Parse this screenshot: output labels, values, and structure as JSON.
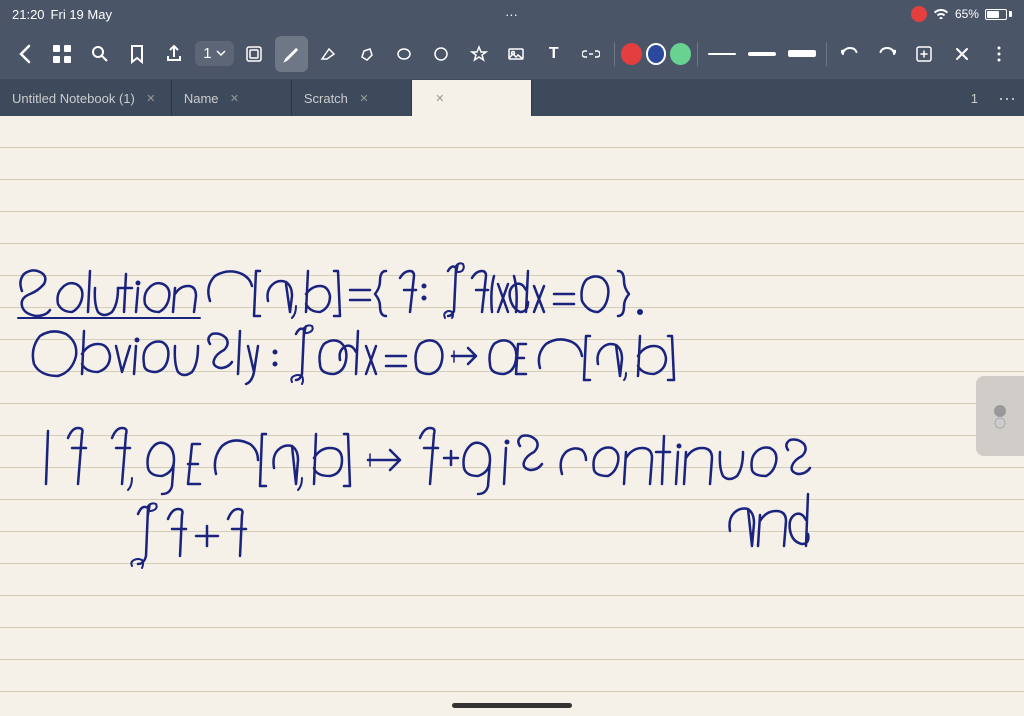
{
  "statusBar": {
    "time": "21:20",
    "day": "Fri 19 May",
    "dots": "···",
    "wifi": "65%"
  },
  "toolbar": {
    "pageIndicator": "1",
    "tools": [
      {
        "name": "back",
        "icon": "‹",
        "label": "back-button"
      },
      {
        "name": "grid",
        "icon": "⊞",
        "label": "grid-button"
      },
      {
        "name": "search",
        "icon": "🔍",
        "label": "search-button"
      },
      {
        "name": "bookmark",
        "icon": "🔖",
        "label": "bookmark-button"
      },
      {
        "name": "share",
        "icon": "⬆",
        "label": "share-button"
      }
    ],
    "drawTools": [
      {
        "name": "layers",
        "icon": "▣",
        "label": "layers-button"
      },
      {
        "name": "pen",
        "icon": "✏",
        "label": "pen-button",
        "active": true
      },
      {
        "name": "eraser",
        "icon": "◻",
        "label": "eraser-button"
      },
      {
        "name": "highlighter",
        "icon": "⬡",
        "label": "highlighter-button"
      },
      {
        "name": "lasso",
        "icon": "◯",
        "label": "lasso-button"
      },
      {
        "name": "shapes",
        "icon": "⬟",
        "label": "shapes-button"
      },
      {
        "name": "star",
        "icon": "☆",
        "label": "star-button"
      },
      {
        "name": "image",
        "icon": "🖼",
        "label": "image-button"
      },
      {
        "name": "text",
        "icon": "T",
        "label": "text-button"
      },
      {
        "name": "link",
        "icon": "🔗",
        "label": "link-button"
      }
    ],
    "colors": [
      {
        "color": "#e53e3e",
        "label": "red-color"
      },
      {
        "color": "#2b4a9e",
        "label": "blue-color",
        "selected": true
      },
      {
        "color": "#68d391",
        "label": "green-color"
      }
    ],
    "thicknesses": [
      {
        "width": 2,
        "label": "thin-line"
      },
      {
        "width": 4,
        "label": "medium-line"
      },
      {
        "width": 7,
        "label": "thick-line"
      }
    ],
    "rightTools": [
      {
        "name": "undo",
        "icon": "↩",
        "label": "undo-button"
      },
      {
        "name": "redo",
        "icon": "↪",
        "label": "redo-button"
      },
      {
        "name": "addpage",
        "icon": "⊕",
        "label": "addpage-button"
      },
      {
        "name": "close",
        "icon": "✕",
        "label": "close-button"
      },
      {
        "name": "more",
        "icon": "···",
        "label": "more-button"
      }
    ]
  },
  "tabs": [
    {
      "label": "Untitled Notebook (1)",
      "active": false,
      "closeable": true
    },
    {
      "label": "Name",
      "active": false,
      "closeable": true
    },
    {
      "label": "Scratch",
      "active": false,
      "closeable": true
    },
    {
      "label": "",
      "active": true,
      "closeable": true
    }
  ],
  "page": {
    "number": "1"
  },
  "content": {
    "handwriting": "Solution  C[a,b] = { f:  ∫ₐᵇ f(x)dx = 0 }. Obviously: ∫ₐᵇ 0 dx=0 ⇒ 0∈C[a,b] If f,g ∈ C[a,b] ⇒ f+g is continuous and ∫ₐᵇ f+"
  }
}
